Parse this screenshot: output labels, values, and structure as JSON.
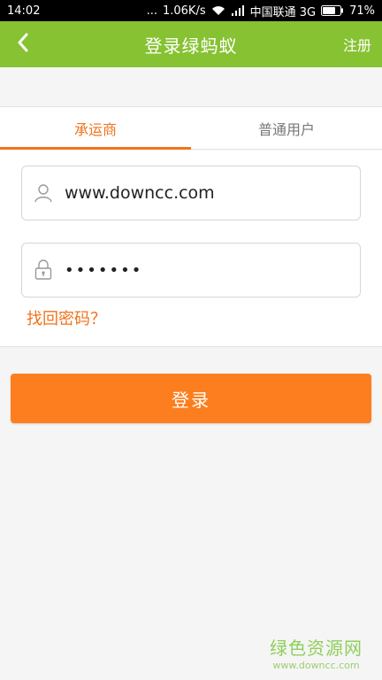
{
  "status_bar": {
    "time": "14:02",
    "dots": "...",
    "speed": "1.06K/s",
    "carrier": "中国联通 3G",
    "battery": "71%"
  },
  "app_bar": {
    "title": "登录绿蚂蚁",
    "register_label": "注册"
  },
  "tabs": [
    {
      "label": "承运商",
      "active": true
    },
    {
      "label": "普通用户",
      "active": false
    }
  ],
  "form": {
    "username_value": "www.downcc.com",
    "password_value": "•••••••",
    "forgot_label": "找回密码？"
  },
  "login_button": {
    "label": "登录"
  },
  "watermark": {
    "main": "绿色资源网",
    "sub": "www.downcc.com"
  },
  "colors": {
    "header_green": "#86c232",
    "accent_orange": "#f0731c",
    "button_orange": "#fd7e1e"
  }
}
